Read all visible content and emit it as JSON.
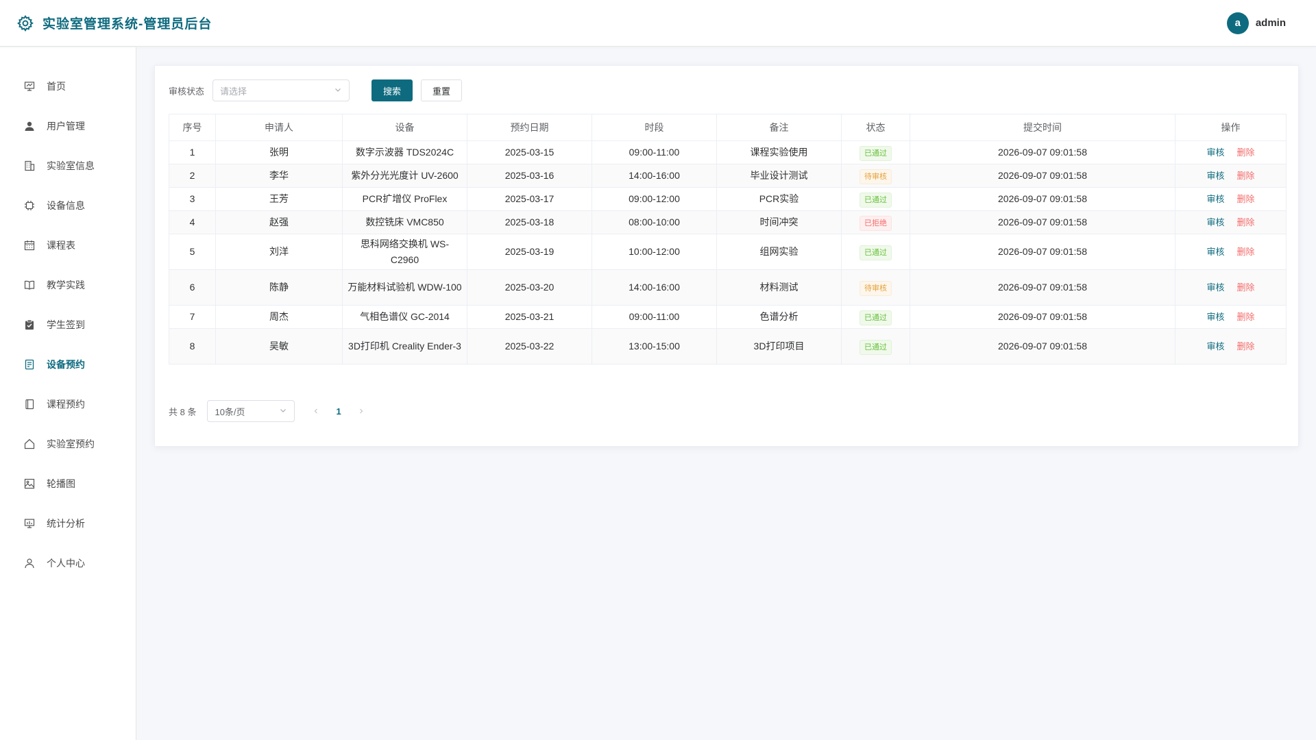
{
  "header": {
    "title": "实验室管理系统-管理员后台",
    "avatar_letter": "a",
    "username": "admin"
  },
  "sidebar": {
    "items": [
      {
        "label": "首页",
        "icon": "presentation-icon"
      },
      {
        "label": "用户管理",
        "icon": "user-icon"
      },
      {
        "label": "实验室信息",
        "icon": "building-icon"
      },
      {
        "label": "设备信息",
        "icon": "chip-icon"
      },
      {
        "label": "课程表",
        "icon": "calendar-icon"
      },
      {
        "label": "教学实践",
        "icon": "book-icon"
      },
      {
        "label": "学生签到",
        "icon": "clipboard-check-icon"
      },
      {
        "label": "设备预约",
        "icon": "document-icon",
        "active": true
      },
      {
        "label": "课程预约",
        "icon": "notebook-icon"
      },
      {
        "label": "实验室预约",
        "icon": "house-icon"
      },
      {
        "label": "轮播图",
        "icon": "picture-icon"
      },
      {
        "label": "统计分析",
        "icon": "chart-board-icon"
      },
      {
        "label": "个人中心",
        "icon": "user-outline-icon"
      }
    ]
  },
  "filter": {
    "label": "审核状态",
    "placeholder": "请选择",
    "search_label": "搜索",
    "reset_label": "重置"
  },
  "table": {
    "columns": [
      "序号",
      "申请人",
      "设备",
      "预约日期",
      "时段",
      "备注",
      "状态",
      "提交时间",
      "操作"
    ],
    "rows": [
      {
        "no": "1",
        "applicant": "张明",
        "device": "数字示波器 TDS2024C",
        "date": "2025-03-15",
        "slot": "09:00-11:00",
        "note": "课程实验使用",
        "status": "已通过",
        "status_type": "success",
        "submitted": "2026-09-07 09:01:58"
      },
      {
        "no": "2",
        "applicant": "李华",
        "device": "紫外分光光度计 UV-2600",
        "date": "2025-03-16",
        "slot": "14:00-16:00",
        "note": "毕业设计测试",
        "status": "待审核",
        "status_type": "warning",
        "submitted": "2026-09-07 09:01:58"
      },
      {
        "no": "3",
        "applicant": "王芳",
        "device": "PCR扩增仪 ProFlex",
        "date": "2025-03-17",
        "slot": "09:00-12:00",
        "note": "PCR实验",
        "status": "已通过",
        "status_type": "success",
        "submitted": "2026-09-07 09:01:58"
      },
      {
        "no": "4",
        "applicant": "赵强",
        "device": "数控铣床 VMC850",
        "date": "2025-03-18",
        "slot": "08:00-10:00",
        "note": "时间冲突",
        "status": "已拒绝",
        "status_type": "danger",
        "submitted": "2026-09-07 09:01:58"
      },
      {
        "no": "5",
        "applicant": "刘洋",
        "device": "思科网络交换机 WS-C2960",
        "date": "2025-03-19",
        "slot": "10:00-12:00",
        "note": "组网实验",
        "status": "已通过",
        "status_type": "success",
        "submitted": "2026-09-07 09:01:58"
      },
      {
        "no": "6",
        "applicant": "陈静",
        "device": "万能材料试验机 WDW-100",
        "date": "2025-03-20",
        "slot": "14:00-16:00",
        "note": "材料测试",
        "status": "待审核",
        "status_type": "warning",
        "submitted": "2026-09-07 09:01:58"
      },
      {
        "no": "7",
        "applicant": "周杰",
        "device": "气相色谱仪 GC-2014",
        "date": "2025-03-21",
        "slot": "09:00-11:00",
        "note": "色谱分析",
        "status": "已通过",
        "status_type": "success",
        "submitted": "2026-09-07 09:01:58"
      },
      {
        "no": "8",
        "applicant": "吴敏",
        "device": "3D打印机 Creality Ender-3",
        "date": "2025-03-22",
        "slot": "13:00-15:00",
        "note": "3D打印项目",
        "status": "已通过",
        "status_type": "success",
        "submitted": "2026-09-07 09:01:58"
      }
    ],
    "actions": {
      "audit": "审核",
      "delete": "删除"
    }
  },
  "pagination": {
    "total_text": "共 8 条",
    "page_size": "10条/页",
    "current_page": "1"
  },
  "colors": {
    "primary": "#0e6b7f",
    "success": "#67c23a",
    "warning": "#e6a23c",
    "danger": "#f56c6c"
  }
}
